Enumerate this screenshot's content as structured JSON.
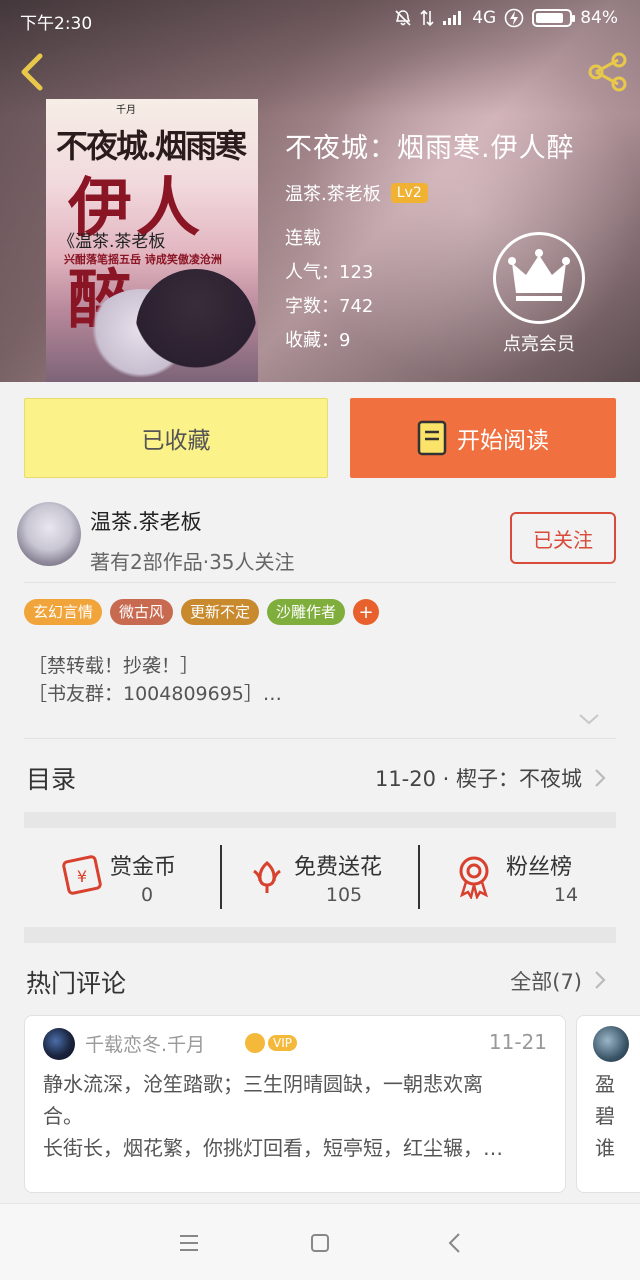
{
  "status_bar": {
    "time": "下午2:30",
    "network": "4G",
    "battery": "84%",
    "battery_level": 0.84
  },
  "book": {
    "title": "不夜城：烟雨寒.伊人醉",
    "author": "温茶.茶老板",
    "level": "Lv2",
    "status": "连载",
    "popularity": "人气：123",
    "word_count": "字数：742",
    "favorites": "收藏：9",
    "cover": {
      "brand": "千月",
      "title": "不夜城.烟雨寒",
      "big_title": "伊人醉",
      "author": "《温茶.茶老板",
      "tagline": "兴酣落笔摇五岳  诗成笑傲凌沧洲"
    }
  },
  "member": {
    "label": "点亮会员"
  },
  "actions": {
    "favorite_label": "已收藏",
    "read_label": "开始阅读"
  },
  "author_info": {
    "name": "温茶.茶老板",
    "stats": "著有2部作品·35人关注",
    "follow_label": "已关注"
  },
  "tags": [
    {
      "label": "玄幻言情",
      "color": "#f0a43a"
    },
    {
      "label": "微古风",
      "color": "#c76a4f"
    },
    {
      "label": "更新不定",
      "color": "#c98a2e"
    },
    {
      "label": "沙雕作者",
      "color": "#7fae3c"
    }
  ],
  "tag_more": "+",
  "description": {
    "line1": "［禁转载！抄袭！］",
    "line2": "［书友群：1004809695］…"
  },
  "toc": {
    "title": "目录",
    "latest": "11-20 · 楔子：不夜城"
  },
  "stats": [
    {
      "label": "赏金币",
      "value": "0",
      "icon": "red-envelope-icon"
    },
    {
      "label": "免费送花",
      "value": "105",
      "icon": "flower-icon"
    },
    {
      "label": "粉丝榜",
      "value": "14",
      "icon": "award-ribbon-icon"
    }
  ],
  "comments": {
    "title": "热门评论",
    "all_label": "全部(7)",
    "items": [
      {
        "user": "千载恋冬.千月",
        "badge": "VIP",
        "date": "11-21",
        "line1": "静水流深，沧笙踏歌；三生阴晴圆缺，一朝悲欢离",
        "line2": "合。",
        "line3": "长街长，烟花繁，你挑灯回看，短亭短，红尘辗，…"
      }
    ],
    "next_preview": {
      "line1": "盈",
      "line2": "碧",
      "line3": "谁"
    }
  },
  "colors": {
    "accent": "#f0713f",
    "favorite_bg": "#fbf289",
    "follow": "#d84a3a",
    "vip": "#f4b93a"
  }
}
